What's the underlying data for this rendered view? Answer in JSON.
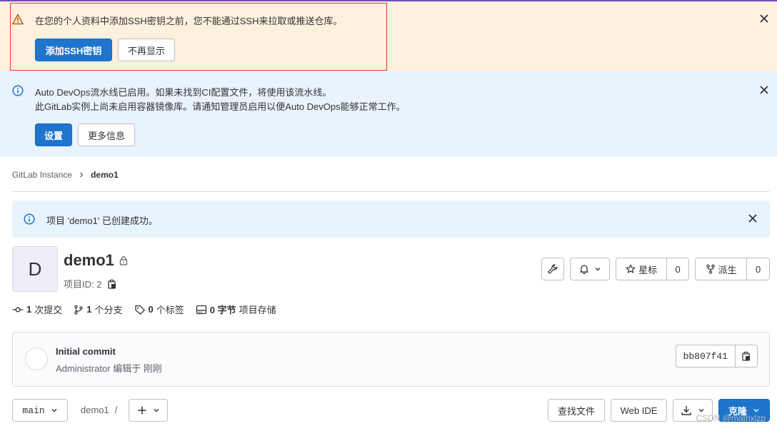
{
  "ssh_alert": {
    "message": "在您的个人资料中添加SSH密钥之前，您不能通过SSH来拉取或推送仓库。",
    "add_key_label": "添加SSH密钥",
    "dismiss_label": "不再显示"
  },
  "devops_alert": {
    "line1": "Auto DevOps流水线已启用。如果未找到CI配置文件，将使用该流水线。",
    "line2": "此GitLab实例上尚未启用容器镜像库。请通知管理员启用以便Auto DevOps能够正常工作。",
    "settings_label": "设置",
    "more_info_label": "更多信息"
  },
  "breadcrumb": {
    "root": "GitLab Instance",
    "current": "demo1"
  },
  "success_alert": {
    "message": "项目 'demo1' 已创建成功。"
  },
  "project": {
    "avatar_letter": "D",
    "name": "demo1",
    "id_label": "项目ID: 2"
  },
  "actions": {
    "star_label": "星标",
    "star_count": "0",
    "fork_label": "派生",
    "fork_count": "0"
  },
  "stats": {
    "commits_count": "1",
    "commits_label": "次提交",
    "branches_count": "1",
    "branches_label": "个分支",
    "tags_count": "0",
    "tags_label": "个标签",
    "storage_count": "0 字节",
    "storage_label": "项目存储"
  },
  "commit": {
    "title": "Initial commit",
    "meta": "Administrator 编辑于 刚刚",
    "sha": "bb807f41"
  },
  "toolbar": {
    "branch": "main",
    "path": "demo1",
    "path_sep": "/",
    "find_file_label": "查找文件",
    "web_ide_label": "Web IDE",
    "clone_label": "克隆"
  },
  "watermark": "CSDN @matrixlzp",
  "colors": {
    "primary": "#1f75cb",
    "warning_bg": "#fdf1dd",
    "info_bg": "#e9f3fc",
    "highlight": "#e03a3a"
  }
}
